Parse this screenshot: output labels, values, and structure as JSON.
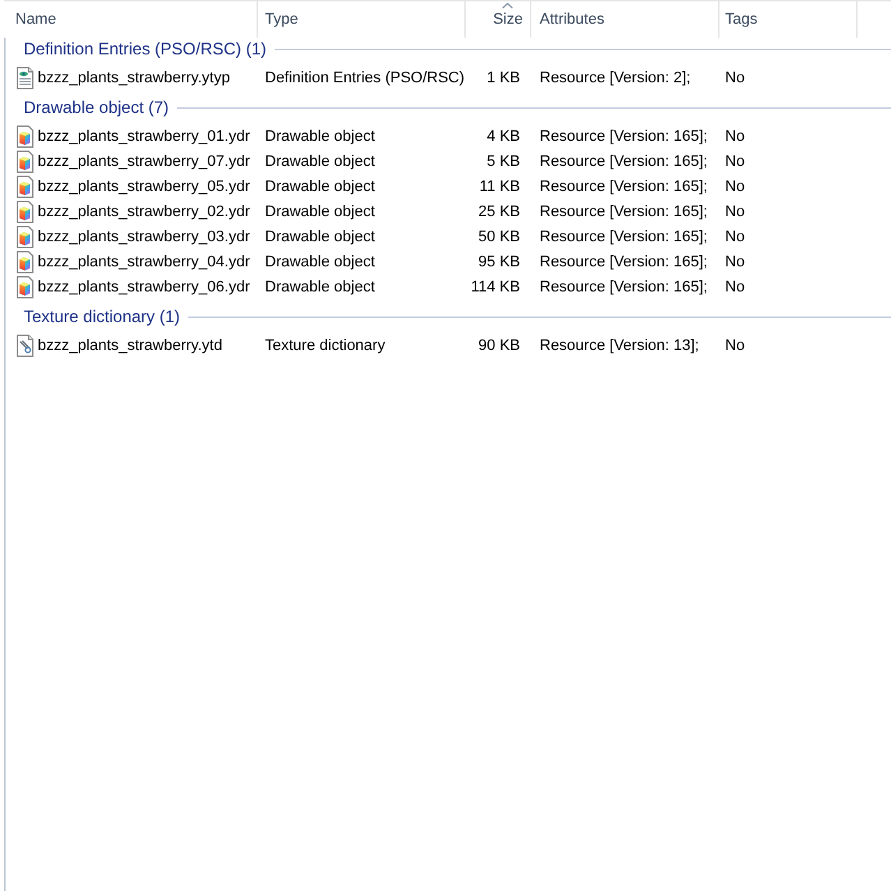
{
  "columns": [
    {
      "label": "Name",
      "sorted": false
    },
    {
      "label": "Type",
      "sorted": false
    },
    {
      "label": "Size",
      "sorted": true
    },
    {
      "label": "Attributes",
      "sorted": false
    },
    {
      "label": "Tags",
      "sorted": false
    }
  ],
  "groups": [
    {
      "title": "Definition Entries (PSO/RSC) (1)",
      "files": [
        {
          "kind": "definition",
          "name": "bzzz_plants_strawberry.ytyp",
          "type": "Definition Entries (PSO/RSC)",
          "size": "1 KB",
          "attributes": "Resource [Version: 2];",
          "tags": "No"
        }
      ]
    },
    {
      "title": "Drawable object (7)",
      "files": [
        {
          "kind": "drawable",
          "name": "bzzz_plants_strawberry_01.ydr",
          "type": "Drawable object",
          "size": "4 KB",
          "attributes": "Resource [Version: 165];",
          "tags": "No"
        },
        {
          "kind": "drawable",
          "name": "bzzz_plants_strawberry_07.ydr",
          "type": "Drawable object",
          "size": "5 KB",
          "attributes": "Resource [Version: 165];",
          "tags": "No"
        },
        {
          "kind": "drawable",
          "name": "bzzz_plants_strawberry_05.ydr",
          "type": "Drawable object",
          "size": "11 KB",
          "attributes": "Resource [Version: 165];",
          "tags": "No"
        },
        {
          "kind": "drawable",
          "name": "bzzz_plants_strawberry_02.ydr",
          "type": "Drawable object",
          "size": "25 KB",
          "attributes": "Resource [Version: 165];",
          "tags": "No"
        },
        {
          "kind": "drawable",
          "name": "bzzz_plants_strawberry_03.ydr",
          "type": "Drawable object",
          "size": "50 KB",
          "attributes": "Resource [Version: 165];",
          "tags": "No"
        },
        {
          "kind": "drawable",
          "name": "bzzz_plants_strawberry_04.ydr",
          "type": "Drawable object",
          "size": "95 KB",
          "attributes": "Resource [Version: 165];",
          "tags": "No"
        },
        {
          "kind": "drawable",
          "name": "bzzz_plants_strawberry_06.ydr",
          "type": "Drawable object",
          "size": "114 KB",
          "attributes": "Resource [Version: 165];",
          "tags": "No"
        }
      ]
    },
    {
      "title": "Texture dictionary (1)",
      "files": [
        {
          "kind": "texture",
          "name": "bzzz_plants_strawberry.ytd",
          "type": "Texture dictionary",
          "size": "90 KB",
          "attributes": "Resource [Version: 13];",
          "tags": "No"
        }
      ]
    }
  ]
}
